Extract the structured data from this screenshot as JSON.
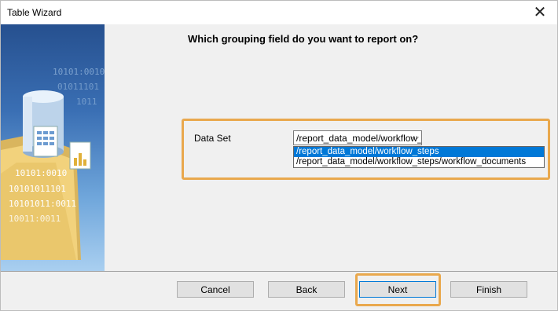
{
  "window": {
    "title": "Table Wizard",
    "close_glyph": "✕"
  },
  "header": {
    "question": "Which grouping field do you want to report on?"
  },
  "form": {
    "dataset_label": "Data Set",
    "dataset_value": "/report_data_model/workflow_",
    "dropdown_arrow": "⌵",
    "options": [
      {
        "label": "/report_data_model/workflow_steps",
        "selected": true
      },
      {
        "label": "/report_data_model/workflow_steps/workflow_documents",
        "selected": false
      }
    ]
  },
  "sidebar": {
    "binary_lines": [
      "10101:0010",
      "01011101",
      "1011",
      "10101:0010",
      "10101011101",
      "10101011:0011",
      "10011:0011"
    ]
  },
  "buttons": {
    "cancel": "Cancel",
    "back": "Back",
    "next": "Next",
    "finish": "Finish"
  },
  "colors": {
    "highlight": "#e9a84d",
    "selection": "#0078d7"
  }
}
